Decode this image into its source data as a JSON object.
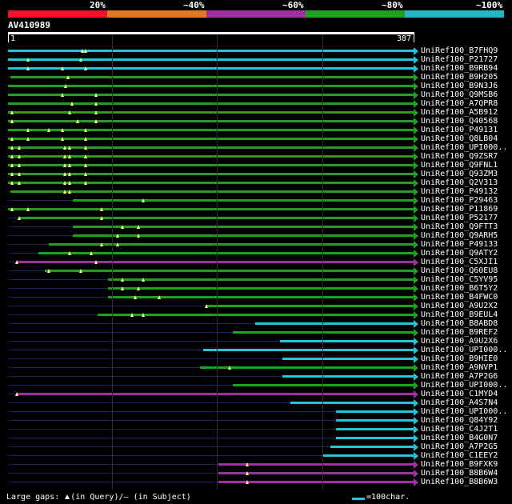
{
  "legend": {
    "colors": [
      "#e8152b",
      "#e5781c",
      "#a030a0",
      "#20a020",
      "#20b8c8"
    ],
    "labels": [
      "20%",
      "~40%",
      "~60%",
      "~80%",
      "~100%"
    ]
  },
  "query": {
    "title": "AV410989",
    "start": "1",
    "end": "387",
    "length": 387
  },
  "hits": [
    {
      "label": "UniRef100_B7FHQ9",
      "color": "#22c4d8",
      "start": 1,
      "gaps": [
        72,
        75
      ]
    },
    {
      "label": "UniRef100_P21727",
      "color": "#22c4d8",
      "start": 1,
      "gaps": [
        20,
        70
      ]
    },
    {
      "label": "UniRef100_B9RB94",
      "color": "#22c4d8",
      "start": 1,
      "gaps": [
        20,
        53,
        75
      ]
    },
    {
      "label": "UniRef100_B9H205",
      "color": "#20a020",
      "start": 3,
      "gaps": [
        58
      ]
    },
    {
      "label": "UniRef100_B9N3J6",
      "color": "#20a020",
      "start": 1,
      "gaps": [
        56
      ]
    },
    {
      "label": "UniRef100_Q9MSB6",
      "color": "#20a020",
      "start": 1,
      "gaps": [
        53,
        85
      ]
    },
    {
      "label": "UniRef100_A7QPR8",
      "color": "#20a020",
      "start": 1,
      "gaps": [
        62,
        85
      ]
    },
    {
      "label": "UniRef100_A5B912",
      "color": "#20a020",
      "start": 1,
      "gaps": [
        5,
        60,
        85
      ]
    },
    {
      "label": "UniRef100_Q40568",
      "color": "#20a020",
      "start": 1,
      "gaps": [
        5,
        67,
        85
      ]
    },
    {
      "label": "UniRef100_P49131",
      "color": "#20a020",
      "start": 1,
      "gaps": [
        20,
        40,
        53,
        75
      ]
    },
    {
      "label": "UniRef100_Q8LB04",
      "color": "#20a020",
      "start": 1,
      "gaps": [
        5,
        20,
        53,
        75
      ]
    },
    {
      "label": "UniRef100_UPI000..",
      "color": "#20a020",
      "start": 1,
      "gaps": [
        5,
        12,
        55,
        60,
        75
      ]
    },
    {
      "label": "UniRef100_Q9ZSR7",
      "color": "#20a020",
      "start": 1,
      "gaps": [
        5,
        12,
        55,
        60,
        75
      ]
    },
    {
      "label": "UniRef100_Q9FNL1",
      "color": "#20a020",
      "start": 1,
      "gaps": [
        5,
        12,
        55,
        60,
        75
      ]
    },
    {
      "label": "UniRef100_Q93ZM3",
      "color": "#20a020",
      "start": 1,
      "gaps": [
        5,
        12,
        55,
        60,
        75
      ]
    },
    {
      "label": "UniRef100_Q2V313",
      "color": "#20a020",
      "start": 1,
      "gaps": [
        5,
        12,
        55,
        60,
        75
      ]
    },
    {
      "label": "UniRef100_P49132",
      "color": "#20a020",
      "start": 3,
      "gaps": [
        55,
        60
      ]
    },
    {
      "label": "UniRef100_P29463",
      "color": "#20a020",
      "start": 63,
      "gaps": [
        130
      ]
    },
    {
      "label": "UniRef100_P11869",
      "color": "#20a020",
      "start": 1,
      "gaps": [
        5,
        20,
        90
      ]
    },
    {
      "label": "UniRef100_P52177",
      "color": "#20a020",
      "start": 12,
      "gaps": [
        12,
        90
      ]
    },
    {
      "label": "UniRef100_Q9FTT3",
      "color": "#20a020",
      "start": 63,
      "gaps": [
        110,
        125
      ]
    },
    {
      "label": "UniRef100_Q9ARH5",
      "color": "#20a020",
      "start": 63,
      "gaps": [
        105,
        125
      ]
    },
    {
      "label": "UniRef100_P49133",
      "color": "#20a020",
      "start": 40,
      "gaps": [
        90,
        105
      ]
    },
    {
      "label": "UniRef100_Q9ATY2",
      "color": "#20a020",
      "start": 30,
      "gaps": [
        60,
        80
      ]
    },
    {
      "label": "UniRef100_C5XJI1",
      "color": "#a030a0",
      "start": 9,
      "gaps": [
        9,
        85
      ]
    },
    {
      "label": "UniRef100_Q60EU8",
      "color": "#20a020",
      "start": 36,
      "gaps": [
        40,
        70
      ]
    },
    {
      "label": "UniRef100_C5YV95",
      "color": "#20a020",
      "start": 96,
      "gaps": [
        110,
        130
      ]
    },
    {
      "label": "UniRef100_B6T5Y2",
      "color": "#20a020",
      "start": 96,
      "gaps": [
        110,
        125
      ]
    },
    {
      "label": "UniRef100_B4FWC0",
      "color": "#20a020",
      "start": 96,
      "gaps": [
        122,
        145
      ]
    },
    {
      "label": "UniRef100_A9U2X2",
      "color": "#20a020",
      "start": 190,
      "gaps": [
        190
      ]
    },
    {
      "label": "UniRef100_B9EUL4",
      "color": "#20a020",
      "start": 86,
      "gaps": [
        119,
        130
      ]
    },
    {
      "label": "UniRef100_B8ABD8",
      "color": "#22c4d8",
      "start": 236,
      "gaps": []
    },
    {
      "label": "UniRef100_B9REF2",
      "color": "#20a020",
      "start": 215,
      "gaps": []
    },
    {
      "label": "UniRef100_A9U2X6",
      "color": "#22c4d8",
      "start": 260,
      "gaps": []
    },
    {
      "label": "UniRef100_UPI000..",
      "color": "#22c4d8",
      "start": 187,
      "gaps": []
    },
    {
      "label": "UniRef100_B9HIE0",
      "color": "#22c4d8",
      "start": 262,
      "gaps": []
    },
    {
      "label": "UniRef100_A9NVP1",
      "color": "#20a020",
      "start": 184,
      "gaps": [
        212
      ]
    },
    {
      "label": "UniRef100_A7P2G6",
      "color": "#22c4d8",
      "start": 262,
      "gaps": []
    },
    {
      "label": "UniRef100_UPI000..",
      "color": "#20a020",
      "start": 215,
      "gaps": []
    },
    {
      "label": "UniRef100_C1MYD4",
      "color": "#a030a0",
      "start": 9,
      "gaps": [
        9
      ]
    },
    {
      "label": "UniRef100_A4S7N4",
      "color": "#22c4d8",
      "start": 270,
      "gaps": []
    },
    {
      "label": "UniRef100_UPI000..",
      "color": "#22c4d8",
      "start": 313,
      "gaps": []
    },
    {
      "label": "UniRef100_Q84Y92",
      "color": "#22c4d8",
      "start": 313,
      "gaps": []
    },
    {
      "label": "UniRef100_C4J2T1",
      "color": "#22c4d8",
      "start": 313,
      "gaps": []
    },
    {
      "label": "UniRef100_B4G0N7",
      "color": "#22c4d8",
      "start": 313,
      "gaps": []
    },
    {
      "label": "UniRef100_A7P2G5",
      "color": "#22c4d8",
      "start": 308,
      "gaps": []
    },
    {
      "label": "UniRef100_C1EEY2",
      "color": "#22c4d8",
      "start": 301,
      "gaps": []
    },
    {
      "label": "UniRef100_B9FXK9",
      "color": "#a030a0",
      "start": 201,
      "gaps": [
        229
      ]
    },
    {
      "label": "UniRef100_B8B6W4",
      "color": "#a030a0",
      "start": 201,
      "gaps": [
        229
      ]
    },
    {
      "label": "UniRef100_B8B6W3",
      "color": "#a030a0",
      "start": 201,
      "gaps": [
        229
      ]
    }
  ],
  "footer": {
    "gaps_label": "Large gaps:",
    "in_query": "(in Query)/",
    "dash": "—",
    "in_subject": "(in Subject)",
    "scale_label": "=100char."
  }
}
